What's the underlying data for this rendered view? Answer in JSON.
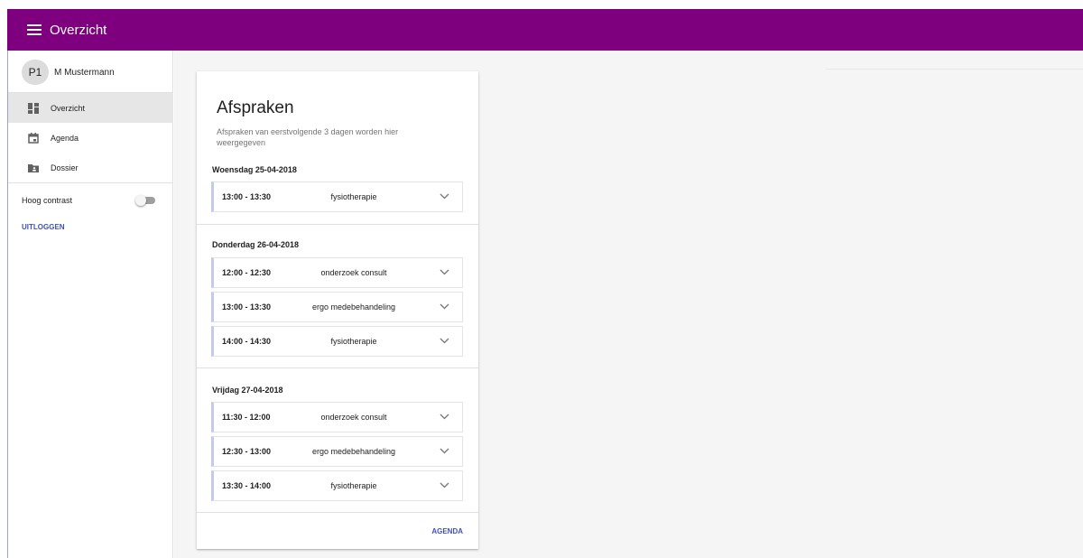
{
  "header": {
    "title": "Overzicht",
    "color": "#7f007f",
    "menu_icon": "menu-icon"
  },
  "sidebar": {
    "user": {
      "initials": "P1",
      "name": "M Mustermann"
    },
    "items": [
      {
        "label": "Overzicht",
        "icon": "dashboard-icon",
        "active": true
      },
      {
        "label": "Agenda",
        "icon": "calendar-icon",
        "active": false
      },
      {
        "label": "Dossier",
        "icon": "folder-icon",
        "active": false
      }
    ],
    "contrast": {
      "label": "Hoog contrast",
      "enabled": false
    },
    "logout": "UITLOGGEN"
  },
  "card": {
    "title": "Afspraken",
    "subtitle": "Afspraken van eerstvolgende 3 dagen worden hier weergegeven",
    "days": [
      {
        "date": "Woensdag 25-04-2018",
        "appointments": [
          {
            "time": "13:00 - 13:30",
            "desc": "fysiotherapie"
          }
        ]
      },
      {
        "date": "Donderdag 26-04-2018",
        "appointments": [
          {
            "time": "12:00 - 12:30",
            "desc": "onderzoek consult"
          },
          {
            "time": "13:00 - 13:30",
            "desc": "ergo medebehandeling"
          },
          {
            "time": "14:00 - 14:30",
            "desc": "fysiotherapie"
          }
        ]
      },
      {
        "date": "Vrijdag 27-04-2018",
        "appointments": [
          {
            "time": "11:30 - 12:00",
            "desc": "onderzoek consult"
          },
          {
            "time": "12:30 - 13:00",
            "desc": "ergo medebehandeling"
          },
          {
            "time": "13:30 - 14:00",
            "desc": "fysiotherapie"
          }
        ]
      }
    ],
    "action": "AGENDA"
  },
  "colors": {
    "accent": "#3f51b5",
    "appointment_bar": "#c5cae9"
  }
}
